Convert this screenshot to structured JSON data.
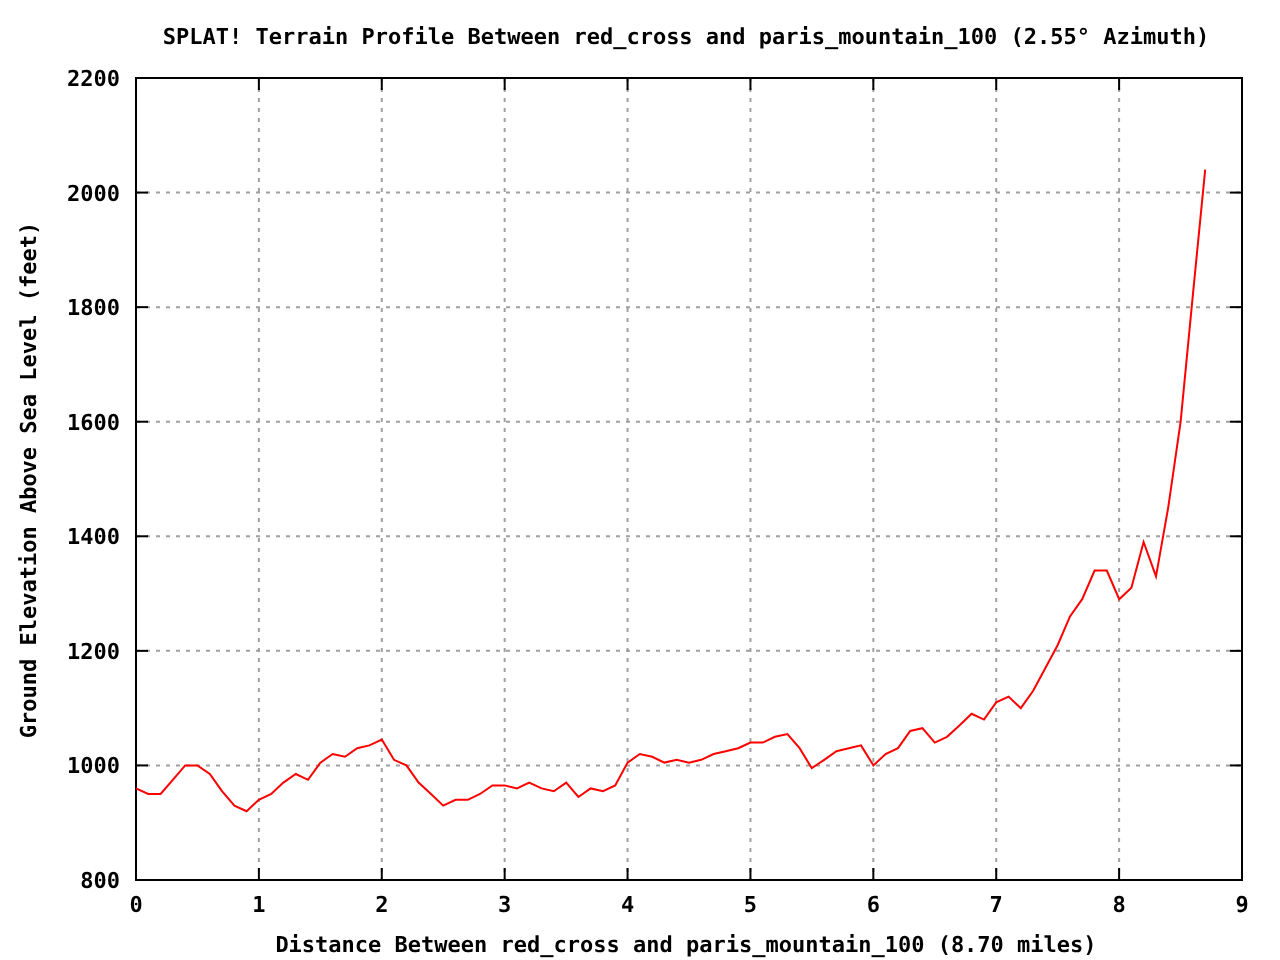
{
  "chart": {
    "chart_data": {
      "type": "line",
      "title": "SPLAT! Terrain Profile Between red_cross and paris_mountain_100 (2.55° Azimuth)",
      "xlabel": "Distance Between red_cross and paris_mountain_100 (8.70 miles)",
      "ylabel": "Ground Elevation Above Sea Level (feet)",
      "x": [
        0,
        0.1,
        0.2,
        0.3,
        0.4,
        0.5,
        0.6,
        0.7,
        0.8,
        0.9,
        1.0,
        1.1,
        1.2,
        1.3,
        1.4,
        1.5,
        1.6,
        1.7,
        1.8,
        1.9,
        2.0,
        2.1,
        2.2,
        2.3,
        2.4,
        2.5,
        2.6,
        2.7,
        2.8,
        2.9,
        3.0,
        3.1,
        3.2,
        3.3,
        3.4,
        3.5,
        3.6,
        3.7,
        3.8,
        3.9,
        4.0,
        4.1,
        4.2,
        4.3,
        4.4,
        4.5,
        4.6,
        4.7,
        4.8,
        4.9,
        5.0,
        5.1,
        5.2,
        5.3,
        5.4,
        5.5,
        5.6,
        5.7,
        5.8,
        5.9,
        6.0,
        6.1,
        6.2,
        6.3,
        6.4,
        6.5,
        6.6,
        6.7,
        6.8,
        6.9,
        7.0,
        7.1,
        7.2,
        7.3,
        7.4,
        7.5,
        7.6,
        7.7,
        7.8,
        7.9,
        8.0,
        8.1,
        8.2,
        8.3,
        8.4,
        8.5,
        8.6,
        8.7
      ],
      "grid": true,
      "series": [
        {
          "color": "#ff0000",
          "values": [
            960,
            950,
            950,
            975,
            1000,
            1000,
            985,
            955,
            930,
            920,
            940,
            950,
            970,
            985,
            975,
            1005,
            1020,
            1015,
            1030,
            1035,
            1045,
            1010,
            1000,
            970,
            950,
            930,
            940,
            940,
            950,
            965,
            965,
            960,
            970,
            960,
            955,
            970,
            945,
            960,
            955,
            965,
            1005,
            1020,
            1015,
            1005,
            1010,
            1005,
            1010,
            1020,
            1025,
            1030,
            1040,
            1040,
            1050,
            1055,
            1030,
            995,
            1010,
            1025,
            1030,
            1035,
            1000,
            1020,
            1030,
            1060,
            1065,
            1040,
            1050,
            1070,
            1090,
            1080,
            1110,
            1120,
            1100,
            1130,
            1170,
            1210,
            1260,
            1290,
            1340,
            1340,
            1290,
            1310,
            1390,
            1330,
            1450,
            1600,
            1820,
            2040
          ]
        }
      ],
      "xlim": [
        0,
        9
      ],
      "ylim": [
        800,
        2200
      ],
      "xticks": [
        0,
        1,
        2,
        3,
        4,
        5,
        6,
        7,
        8,
        9
      ],
      "yticks": [
        800,
        1000,
        1200,
        1400,
        1600,
        1800,
        2000,
        2200
      ]
    }
  }
}
